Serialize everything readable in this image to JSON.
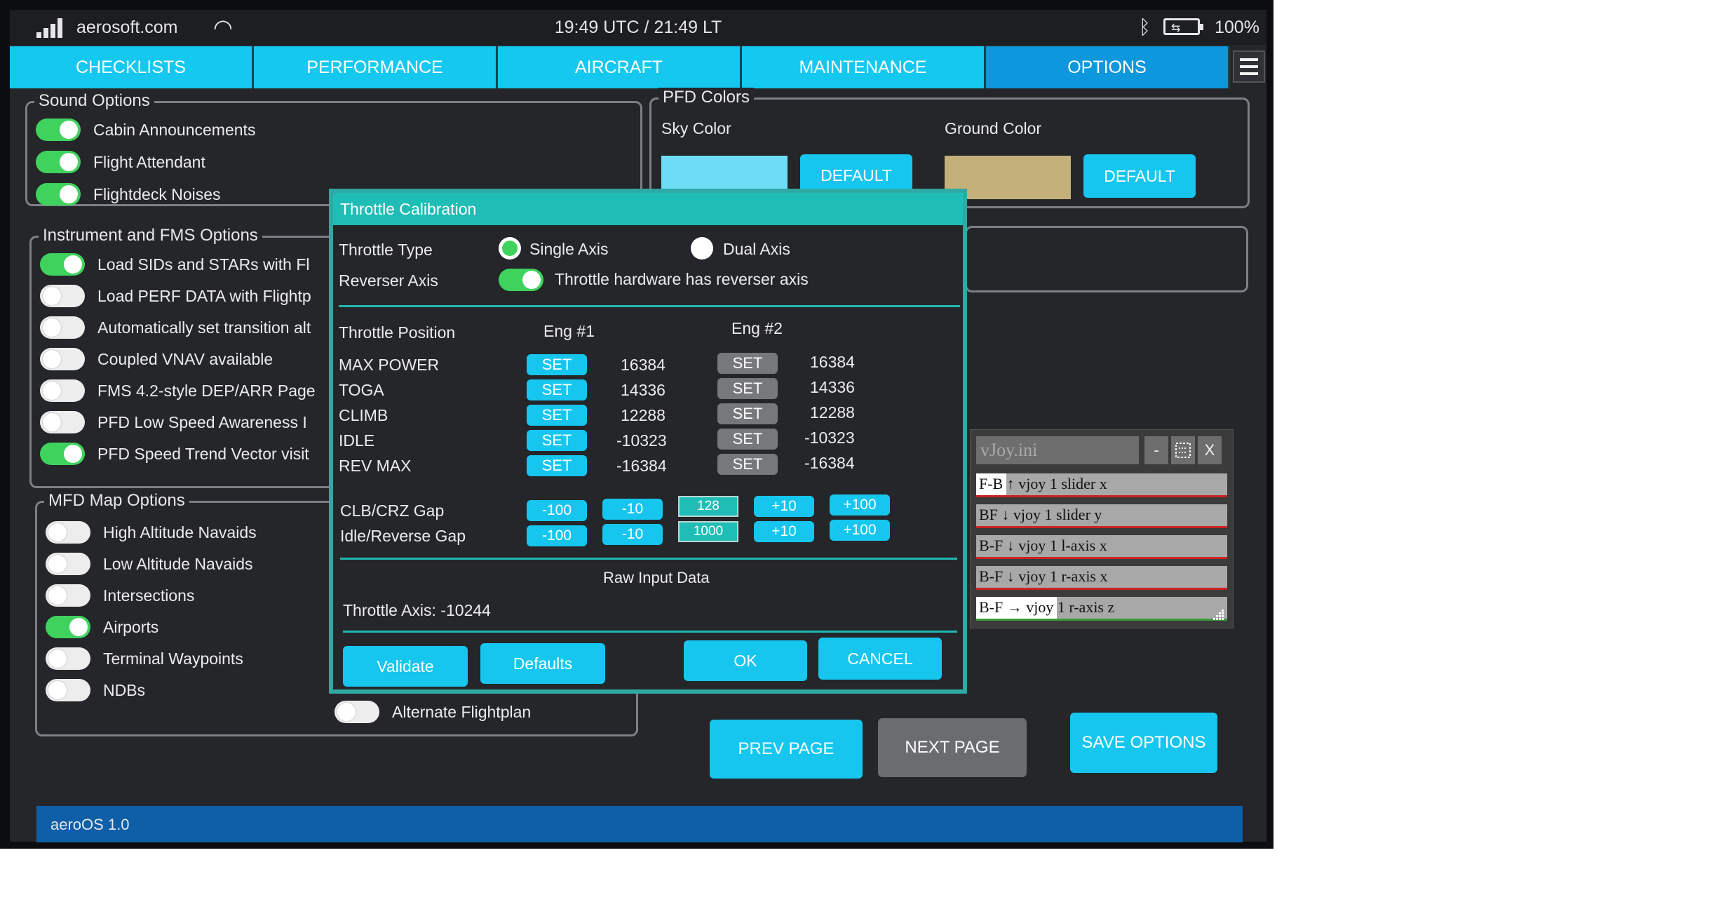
{
  "status_bar": {
    "carrier": "aerosoft.com",
    "clock": "19:49 UTC / 21:49 LT",
    "battery_pct": "100%"
  },
  "tabs": [
    "CHECKLISTS",
    "PERFORMANCE",
    "AIRCRAFT",
    "MAINTENANCE",
    "OPTIONS"
  ],
  "active_tab": "OPTIONS",
  "sound_options": {
    "title": "Sound Options",
    "items": [
      {
        "label": "Cabin Announcements",
        "on": true
      },
      {
        "label": "Flight Attendant",
        "on": true
      },
      {
        "label": "Flightdeck Noises",
        "on": true
      }
    ]
  },
  "fms_options": {
    "title": "Instrument and FMS Options",
    "items": [
      {
        "label": "Load SIDs and STARs with Fl",
        "on": true
      },
      {
        "label": "Load PERF DATA with Flightp",
        "on": false
      },
      {
        "label": "Automatically set transition alt",
        "on": false
      },
      {
        "label": "Coupled VNAV available",
        "on": false
      },
      {
        "label": "FMS 4.2-style DEP/ARR Page",
        "on": false
      },
      {
        "label": "PFD Low Speed Awareness I",
        "on": false
      },
      {
        "label": "PFD Speed Trend Vector visit",
        "on": true
      }
    ]
  },
  "mfd_options": {
    "title": "MFD Map Options",
    "items": [
      {
        "label": "High Altitude Navaids",
        "on": false
      },
      {
        "label": "Low Altitude Navaids",
        "on": false
      },
      {
        "label": "Intersections",
        "on": false
      },
      {
        "label": "Airports",
        "on": true
      },
      {
        "label": "Terminal Waypoints",
        "on": false
      },
      {
        "label": "NDBs",
        "on": false
      }
    ],
    "extra": {
      "label": "Alternate Flightplan",
      "on": false
    }
  },
  "pfd_colors": {
    "title": "PFD Colors",
    "sky_label": "Sky Color",
    "ground_label": "Ground Color",
    "sky_color": "#6fdcf5",
    "ground_color": "#c3b07a",
    "default_label": "DEFAULT"
  },
  "dialog": {
    "title": "Throttle Calibration",
    "throttle_type_label": "Throttle Type",
    "single_axis": "Single Axis",
    "dual_axis": "Dual Axis",
    "reverser_label": "Reverser Axis",
    "reverser_text": "Throttle hardware has reverser axis",
    "position_label": "Throttle Position",
    "eng1": "Eng #1",
    "eng2": "Eng #2",
    "set_label": "SET",
    "positions": [
      {
        "name": "MAX POWER",
        "eng1": "16384",
        "eng2": "16384"
      },
      {
        "name": "TOGA",
        "eng1": "14336",
        "eng2": "14336"
      },
      {
        "name": "CLIMB",
        "eng1": "12288",
        "eng2": "12288"
      },
      {
        "name": "IDLE",
        "eng1": "-10323",
        "eng2": "-10323"
      },
      {
        "name": "REV MAX",
        "eng1": "-16384",
        "eng2": "-16384"
      }
    ],
    "gaps": [
      {
        "name": "CLB/CRZ Gap",
        "value": "128"
      },
      {
        "name": "Idle/Reverse Gap",
        "value": "1000"
      }
    ],
    "gap_buttons": [
      "-100",
      "-10",
      "+10",
      "+100"
    ],
    "raw_title": "Raw Input Data",
    "raw_value": "Throttle Axis: -10244",
    "validate": "Validate",
    "defaults": "Defaults",
    "ok": "OK",
    "cancel": "CANCEL"
  },
  "nav": {
    "prev": "PREV PAGE",
    "next": "NEXT PAGE",
    "save": "SAVE OPTIONS"
  },
  "footer": "aeroOS 1.0",
  "vjoy": {
    "title": "vJoy.ini",
    "minimize": "-",
    "close": "X",
    "rows": [
      {
        "label": "F-B ↑ vjoy 1 slider x",
        "level": 0.12
      },
      {
        "label": "BF ↓ vjoy 1 slider y",
        "level": 0.0
      },
      {
        "label": "B-F ↓ vjoy 1 l-axis x",
        "level": 0.0
      },
      {
        "label": "B-F ↓ vjoy 1 r-axis x",
        "level": 0.0
      },
      {
        "label": "B-F → vjoy 1 r-axis z",
        "level": 0.32
      }
    ]
  }
}
